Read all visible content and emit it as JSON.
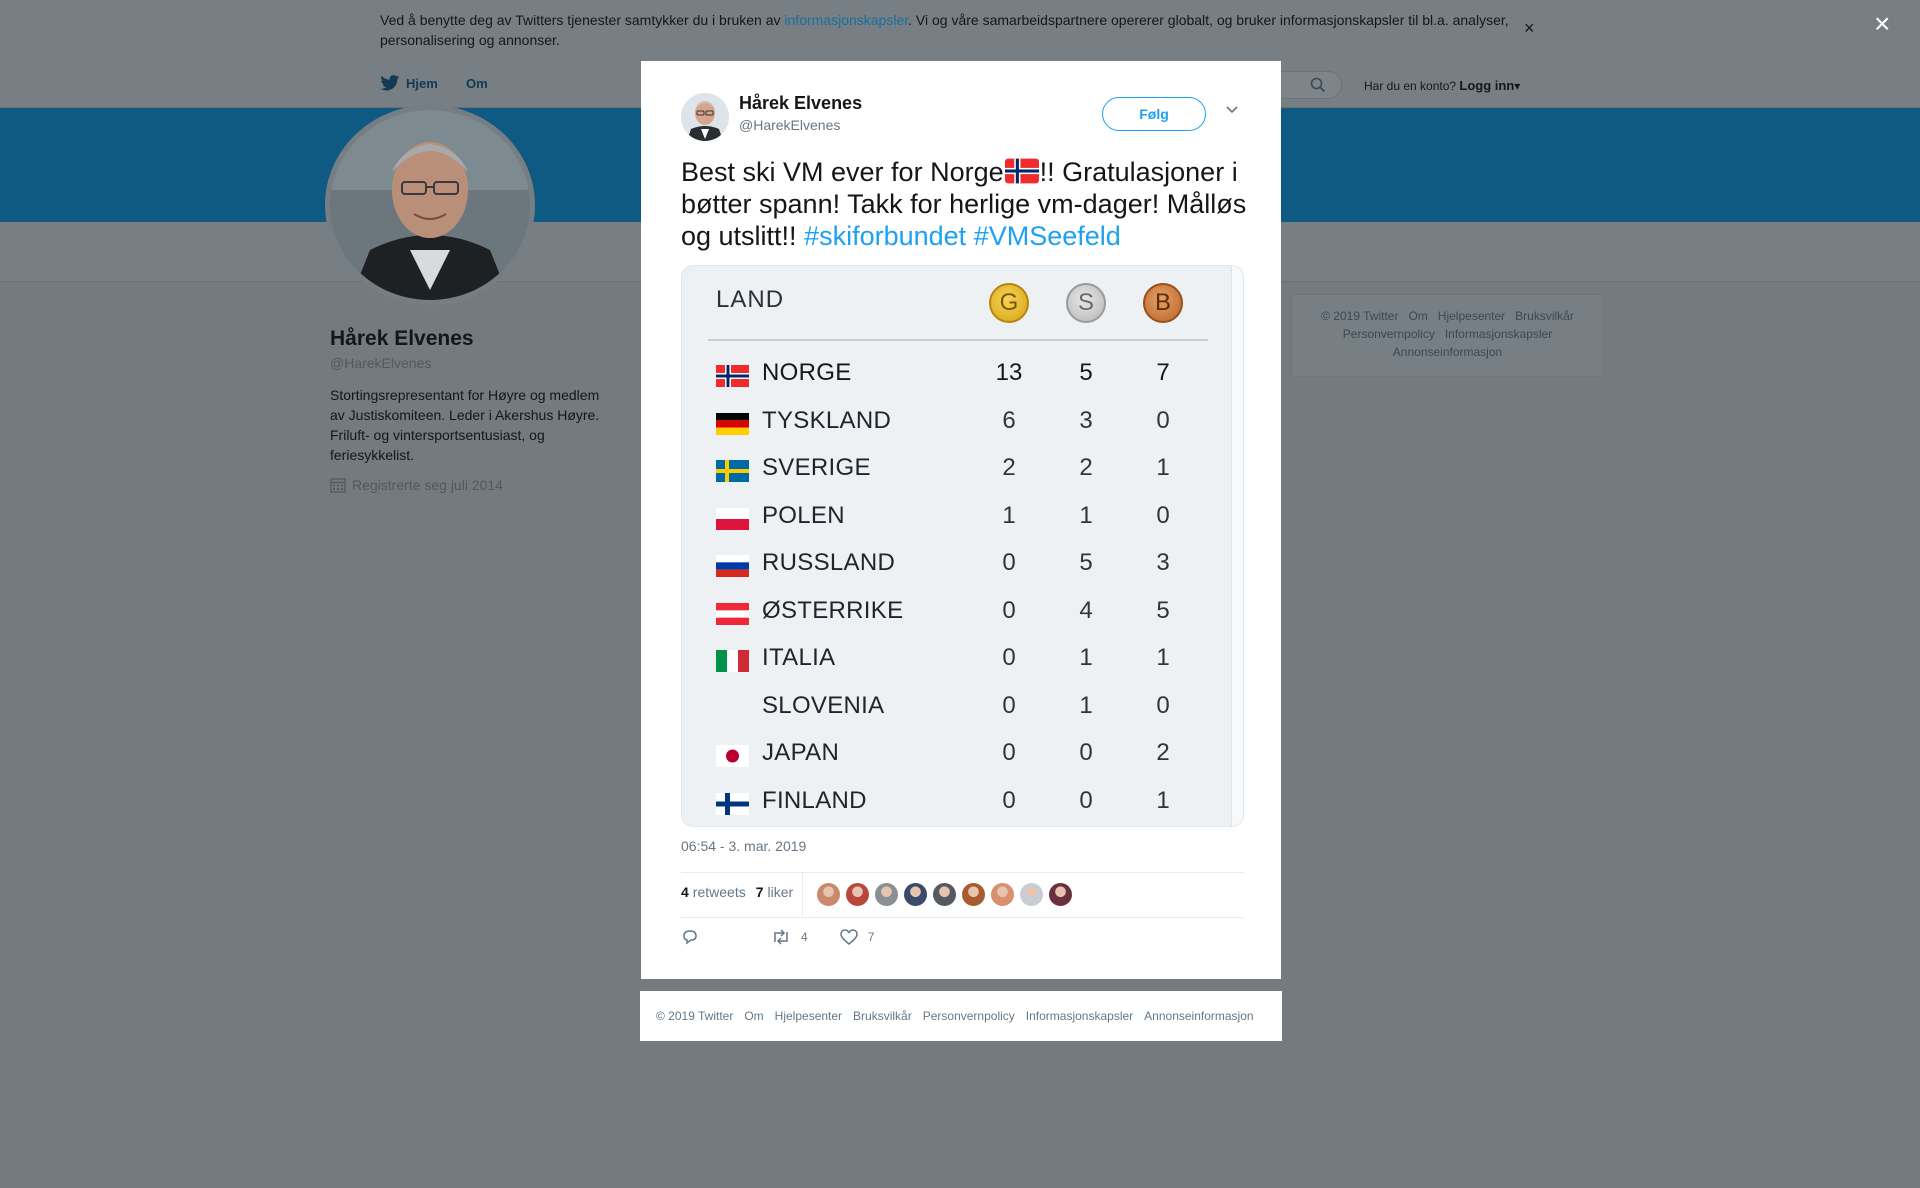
{
  "cookie_bar": {
    "text_before": "Ved å benytte deg av Twitters tjenester samtykker du i bruken av ",
    "link": "informasjonskapsler",
    "text_after": ". Vi og våre samarbeidspartnere opererer globalt, og bruker informasjonskapsler til bl.a. analyser, personalisering og annonser.",
    "close": "×"
  },
  "nav": {
    "home": "Hjem",
    "about": "Om",
    "has_account": "Har du en konto?",
    "login": "Logg inn"
  },
  "profile": {
    "name": "Hårek Elvenes",
    "handle": "@HarekElvenes",
    "bio": "Stortingsrepresentant for Høyre og medlem av Justiskomiteen. Leder i Akershus Høyre. Friluft- og vintersportsentusiast, og feriesykkelist.",
    "joined": "Registrerte seg juli 2014"
  },
  "side_footer": [
    "© 2019 Twitter",
    "Om",
    "Hjelpesenter",
    "Bruksvilkår",
    "Personvernpolicy",
    "Informasjonskapsler",
    "Annonseinformasjon"
  ],
  "modal": {
    "close": "×",
    "author_name": "Hårek Elvenes",
    "author_handle": "@HarekElvenes",
    "follow": "Følg",
    "tweet_part1": "Best ski VM ever for Norge",
    "tweet_part2": "!! Gratulasjoner i bøtter spann! Takk for herlige vm-dager! Målløs og utslitt!! ",
    "hashtag1": "#skiforbundet",
    "hashtag2": "#VMSeefeld",
    "timestamp": "06:54 - 3. mar. 2019",
    "retweets_count": "4",
    "retweets_label": "retweets",
    "likes_count": "7",
    "likes_label": "liker",
    "action_retweets": "4",
    "action_likes": "7",
    "liker_colors": [
      "#c98a6b",
      "#b8473e",
      "#8a8f94",
      "#3a4a6a",
      "#555a60",
      "#a85a30",
      "#d89070",
      "#c8ccd4",
      "#6a3040"
    ]
  },
  "medal_table": {
    "header": "LAND",
    "medals": {
      "gold": "G",
      "silver": "S",
      "bronze": "B"
    },
    "rows": [
      {
        "country": "NORGE",
        "gold": "13",
        "silver": "5",
        "bronze": "7",
        "flag": "no"
      },
      {
        "country": "TYSKLAND",
        "gold": "6",
        "silver": "3",
        "bronze": "0",
        "flag": "de"
      },
      {
        "country": "SVERIGE",
        "gold": "2",
        "silver": "2",
        "bronze": "1",
        "flag": "se"
      },
      {
        "country": "POLEN",
        "gold": "1",
        "silver": "1",
        "bronze": "0",
        "flag": "pl"
      },
      {
        "country": "RUSSLAND",
        "gold": "0",
        "silver": "5",
        "bronze": "3",
        "flag": "ru"
      },
      {
        "country": "ØSTERRIKE",
        "gold": "0",
        "silver": "4",
        "bronze": "5",
        "flag": "at"
      },
      {
        "country": "ITALIA",
        "gold": "0",
        "silver": "1",
        "bronze": "1",
        "flag": "it"
      },
      {
        "country": "SLOVENIA",
        "gold": "0",
        "silver": "1",
        "bronze": "0",
        "flag": "none"
      },
      {
        "country": "JAPAN",
        "gold": "0",
        "silver": "0",
        "bronze": "2",
        "flag": "jp"
      },
      {
        "country": "FINLAND",
        "gold": "0",
        "silver": "0",
        "bronze": "1",
        "flag": "fi"
      }
    ]
  },
  "modal_footer": [
    "© 2019 Twitter",
    "Om",
    "Hjelpesenter",
    "Bruksvilkår",
    "Personvernpolicy",
    "Informasjonskapsler",
    "Annonseinformasjon"
  ],
  "colors": {
    "twitter_blue": "#1da1f2",
    "overlay": "#747a7e"
  }
}
